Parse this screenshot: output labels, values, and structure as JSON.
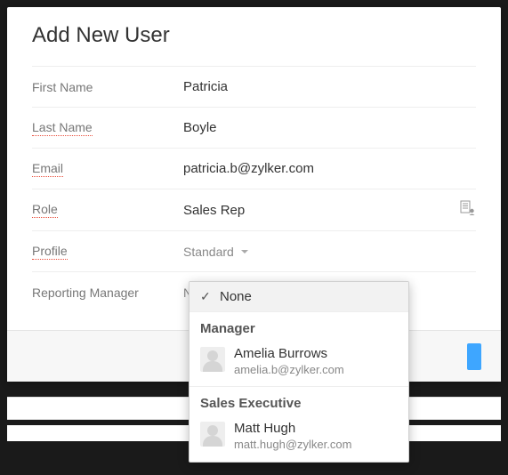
{
  "dialog": {
    "title": "Add New User"
  },
  "fields": {
    "firstName": {
      "label": "First Name",
      "value": "Patricia"
    },
    "lastName": {
      "label": "Last Name",
      "value": "Boyle"
    },
    "email": {
      "label": "Email",
      "value": "patricia.b@zylker.com"
    },
    "role": {
      "label": "Role",
      "value": "Sales Rep"
    },
    "profile": {
      "label": "Profile",
      "value": "Standard"
    },
    "manager": {
      "label": "Reporting Manager",
      "value": "None"
    }
  },
  "dropdown": {
    "noneLabel": "None",
    "groups": [
      {
        "label": "Manager",
        "person": {
          "name": "Amelia Burrows",
          "email": "amelia.b@zylker.com"
        }
      },
      {
        "label": "Sales Executive",
        "person": {
          "name": "Matt Hugh",
          "email": "matt.hugh@zylker.com"
        }
      }
    ]
  }
}
